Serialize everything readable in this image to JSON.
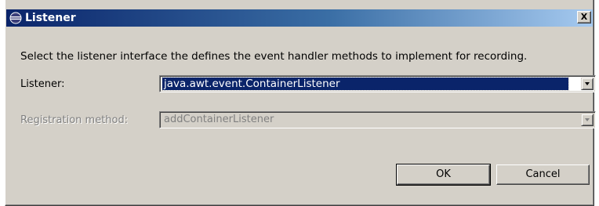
{
  "window": {
    "title": "Listener",
    "icon": "eclipse-icon",
    "close_label": "X"
  },
  "description": "Select the listener interface the defines the event handler methods to implement for recording.",
  "listener_field": {
    "label": "Listener:",
    "value": "java.awt.event.ContainerListener"
  },
  "registration_field": {
    "label": "Registration method:",
    "value": "addContainerListener",
    "enabled": false
  },
  "buttons": {
    "ok_label": "OK",
    "cancel_label": "Cancel"
  },
  "colors": {
    "titlebar_start": "#0a246a",
    "titlebar_end": "#a6caf0",
    "selection": "#0a246a",
    "dialog_bg": "#d4d0c8"
  }
}
